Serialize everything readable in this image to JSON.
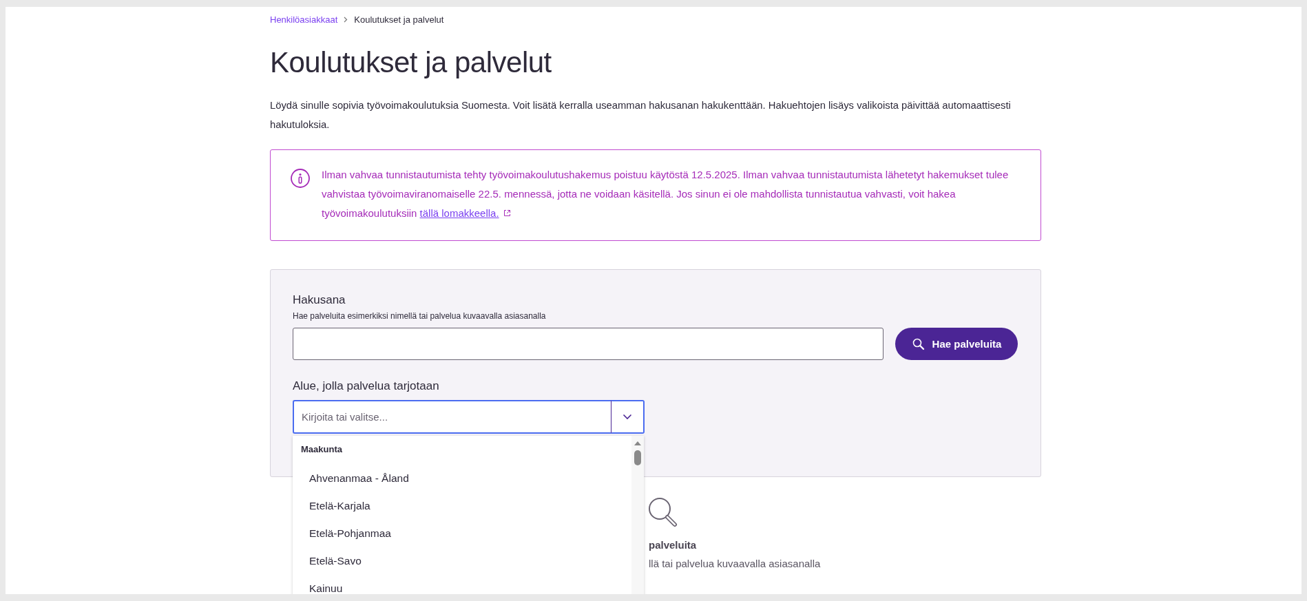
{
  "breadcrumb": [
    {
      "label": "Henkilöasiakkaat",
      "kind": "link"
    },
    {
      "label": "Koulutukset ja palvelut",
      "kind": "current"
    }
  ],
  "title": "Koulutukset ja palvelut",
  "intro": "Löydä sinulle sopivia työvoimakoulutuksia Suomesta. Voit lisätä kerralla useamman hakusanan hakukenttään. Hakuehtojen lisäys valikoista päivittää automaattisesti hakutuloksia.",
  "notice": {
    "text": "Ilman vahvaa tunnistautumista tehty työvoimakoulutushakemus poistuu käytöstä 12.5.2025. Ilman vahvaa tunnistautumista lähetetyt hakemukset tulee vahvistaa työvoimaviranomaiselle 22.5. mennessä, jotta ne voidaan käsitellä. Jos sinun ei ole mahdollista tunnistautua vahvasti, voit hakea työvoimakoulutuksiin",
    "link": "tällä lomakkeella."
  },
  "search": {
    "keyword_label": "Hakusana",
    "keyword_hint": "Hae palveluita esimerkiksi nimellä tai palvelua kuvaavalla asiasanalla",
    "button": "Hae palveluita",
    "area_label": "Alue, jolla palvelua tarjotaan",
    "area_placeholder": "Kirjoita tai valitse...",
    "area_expanded": true
  },
  "dropdown": {
    "group": "Maakunta",
    "options": [
      {
        "label": "Ahvenanmaa - Åland",
        "selected": false
      },
      {
        "label": "Etelä-Karjala",
        "selected": false
      },
      {
        "label": "Etelä-Pohjanmaa",
        "selected": false
      },
      {
        "label": "Etelä-Savo",
        "selected": false
      },
      {
        "label": "Kainuu",
        "selected": false
      }
    ]
  },
  "empty_state": {
    "title": "palveluita",
    "text": "llä tai palvelua kuvaavalla asiasanalla"
  }
}
